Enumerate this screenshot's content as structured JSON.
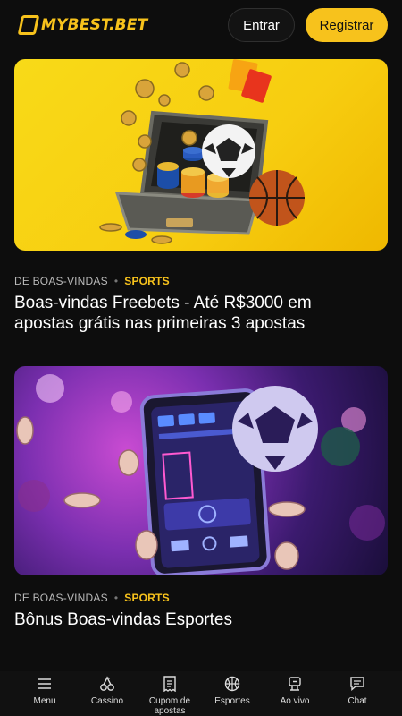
{
  "header": {
    "logo_text": "MYBEST.BET",
    "login_label": "Entrar",
    "register_label": "Registrar"
  },
  "articles": [
    {
      "category": "DE BOAS-VINDAS",
      "tag": "SPORTS",
      "title": "Boas-vindas Freebets - Até R$3000 em apostas grátis nas primeiras 3 apostas"
    },
    {
      "category": "DE BOAS-VINDAS",
      "tag": "SPORTS",
      "title": "Bônus Boas-vindas Esportes"
    }
  ],
  "bottom_nav": [
    {
      "label": "Menu",
      "icon": "menu-icon"
    },
    {
      "label": "Cassino",
      "icon": "cherries-icon"
    },
    {
      "label": "Cupom de apostas",
      "icon": "receipt-icon"
    },
    {
      "label": "Esportes",
      "icon": "basketball-icon"
    },
    {
      "label": "Ao vivo",
      "icon": "live-icon"
    },
    {
      "label": "Chat",
      "icon": "chat-icon"
    }
  ],
  "colors": {
    "accent": "#f7c21c",
    "background": "#0d0d0d"
  }
}
